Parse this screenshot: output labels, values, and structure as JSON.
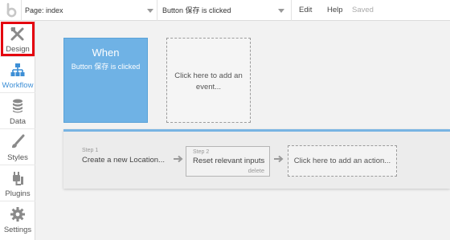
{
  "topbar": {
    "page_label": "Page: index",
    "event_label": "Button 保存 is clicked",
    "edit": "Edit",
    "help": "Help",
    "saved": "Saved"
  },
  "sidebar": {
    "items": [
      {
        "label": "Design",
        "icon": "design-tools-icon"
      },
      {
        "label": "Workflow",
        "icon": "workflow-icon"
      },
      {
        "label": "Data",
        "icon": "database-icon"
      },
      {
        "label": "Styles",
        "icon": "brush-icon"
      },
      {
        "label": "Plugins",
        "icon": "plug-icon"
      },
      {
        "label": "Settings",
        "icon": "gear-icon"
      }
    ],
    "active": "Workflow",
    "highlight_color": "#e4000f"
  },
  "event_card": {
    "title": "When",
    "subtitle": "Button 保存 is clicked",
    "color": "#6fb2e5"
  },
  "add_event": {
    "line1": "Click here to add an",
    "line2": "event..."
  },
  "steps": [
    {
      "label": "Step 1",
      "text": "Create a new Location..."
    },
    {
      "label": "Step 2",
      "text": "Reset relevant inputs",
      "delete": "delete"
    }
  ],
  "add_action": "Click here to add an action..."
}
